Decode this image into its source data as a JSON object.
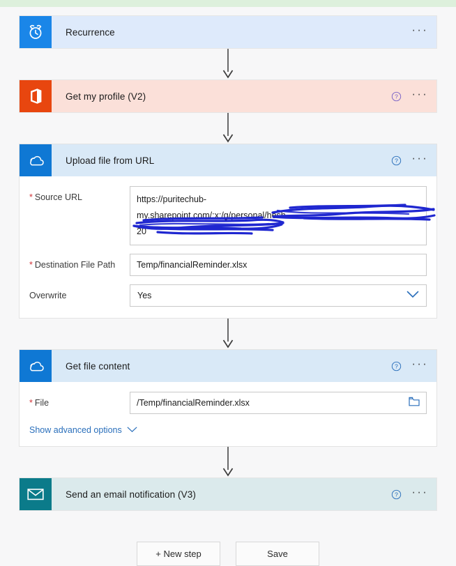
{
  "page": {
    "top_strip_color": "#ddf0dc",
    "background_color": "#f7f7f8"
  },
  "steps": [
    {
      "id": "recurrence",
      "title": "Recurrence",
      "icon": "alarm-clock-icon",
      "tile_color": "#1a86e8",
      "tint_color": "#deeafb",
      "has_help": false,
      "expanded": false
    },
    {
      "id": "get-my-profile",
      "title": "Get my profile (V2)",
      "icon": "office365-icon",
      "tile_color": "#e8460f",
      "tint_color": "#fbe0d9",
      "has_help": true,
      "expanded": false
    },
    {
      "id": "upload-file-from-url",
      "title": "Upload file from URL",
      "icon": "onedrive-cloud-icon",
      "tile_color": "#0f78d4",
      "tint_color": "#d9e9f7",
      "has_help": true,
      "expanded": true,
      "fields": {
        "source_url": {
          "label": "Source URL",
          "required": true,
          "required_marker": "*",
          "value_line1": "https://puritechub-",
          "value_line2": "my.sharepoint.com/:x:/g/personal/hesh",
          "value_line3": "20",
          "redacted": true,
          "redaction_color": "#1f27d0"
        },
        "destination_file_path": {
          "label": "Destination File Path",
          "required": true,
          "required_marker": "*",
          "value": "Temp/financialReminder.xlsx"
        },
        "overwrite": {
          "label": "Overwrite",
          "required": false,
          "value": "Yes",
          "icon": "chevron-down-icon"
        }
      }
    },
    {
      "id": "get-file-content",
      "title": "Get file content",
      "icon": "onedrive-cloud-icon",
      "tile_color": "#0f78d4",
      "tint_color": "#d9e9f7",
      "has_help": true,
      "expanded": true,
      "fields": {
        "file": {
          "label": "File",
          "required": true,
          "required_marker": "*",
          "value": "/Temp/financialReminder.xlsx",
          "icon": "folder-picker-icon"
        },
        "advanced_options": {
          "label": "Show advanced options",
          "icon": "chevron-down-icon"
        }
      }
    },
    {
      "id": "send-email-notification",
      "title": "Send an email notification (V3)",
      "icon": "envelope-icon",
      "tile_color": "#0b7b8a",
      "tint_color": "#dbeaec",
      "has_help": true,
      "expanded": false
    }
  ],
  "footer": {
    "new_step_label": "+ New step",
    "save_label": "Save"
  },
  "icons": {
    "ellipsis": "···",
    "help": "?"
  }
}
